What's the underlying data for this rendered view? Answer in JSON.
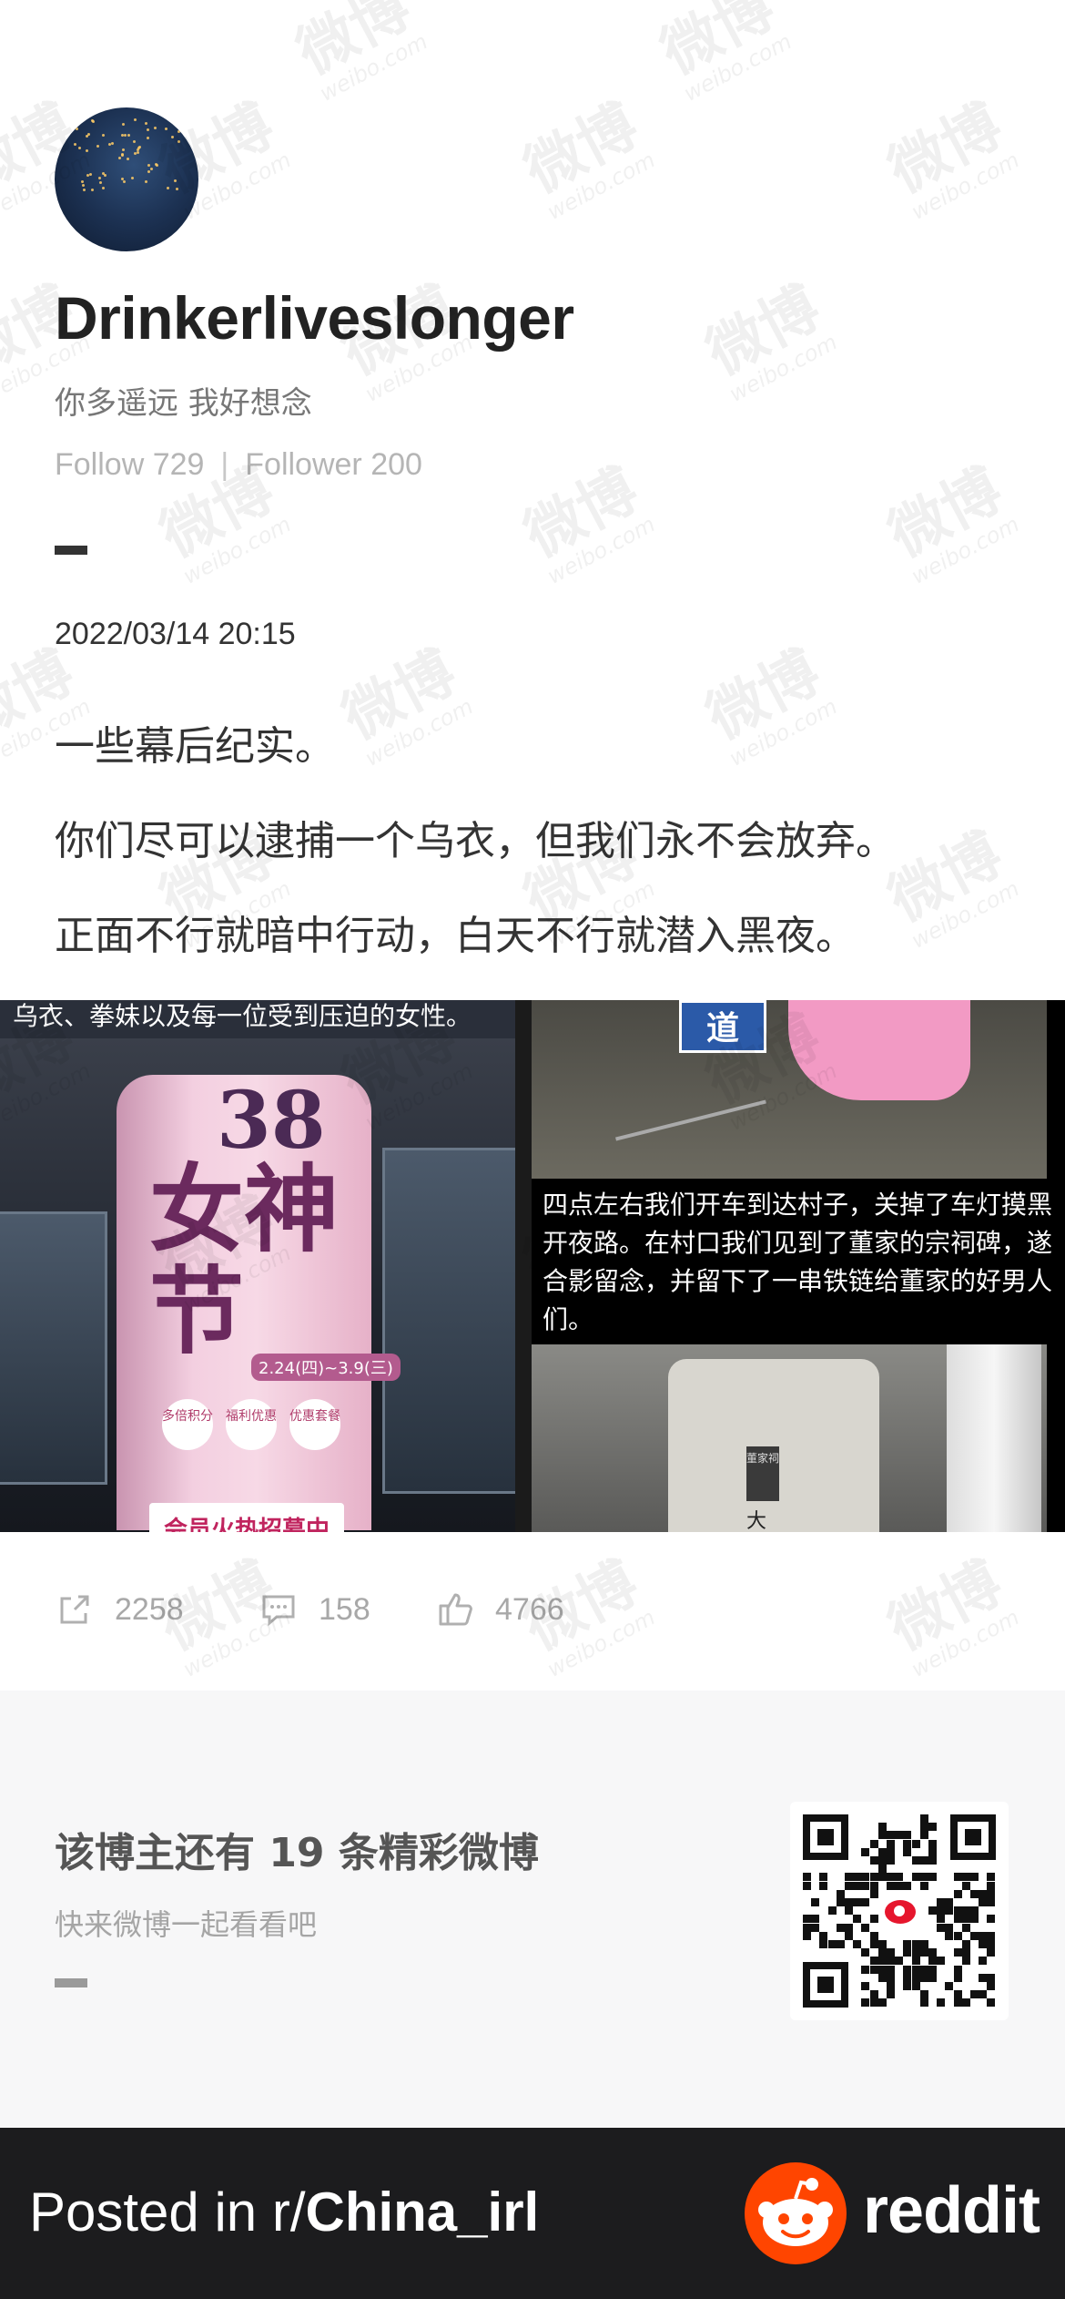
{
  "profile": {
    "username": "Drinkerliveslonger",
    "bio": "你多遥远 我好想念",
    "follow_label": "Follow 729",
    "follower_label": "Follower 200",
    "separator": "|"
  },
  "post": {
    "date": "2022/03/14 20:15",
    "lines": [
      "一些幕后纪实。",
      "你们尽可以逮捕一个乌衣，但我们永不会放弃。",
      "正面不行就暗中行动，白天不行就潜入黑夜。"
    ]
  },
  "images": {
    "left_caption": "乌衣、拳妹以及每一位受到压迫的女性。",
    "pillar_number": "38",
    "pillar_title": "女神节",
    "pillar_date": "2.24(四)~3.9(三)",
    "pillar_tags": [
      "多倍积分",
      "福利优惠",
      "优惠套餐"
    ],
    "pillar_banner": "会员火热招募中",
    "road_sign": "道",
    "right_caption": "四点左右我们开车到达村子，关掉了车灯摸黑开夜路。在村口我们见到了董家的宗祠碑，遂合影留念，并留下了一串铁链给董家的好男人们。",
    "stele_plaque": "董家祠",
    "stele_text": "大"
  },
  "actions": {
    "repost_count": "2258",
    "comment_count": "158",
    "like_count": "4766"
  },
  "more": {
    "title": "该博主还有 19 条精彩微博",
    "subtitle": "快来微博一起看看吧"
  },
  "watermark": {
    "cn": "微博",
    "en": "weibo.com"
  },
  "footer": {
    "posted_prefix": "Posted in r/",
    "subreddit": "China_irl",
    "brand": "reddit"
  },
  "colors": {
    "reddit_orange": "#ff4500",
    "footer_bg": "#1c1c1e",
    "weibo_red": "#e6162d"
  }
}
